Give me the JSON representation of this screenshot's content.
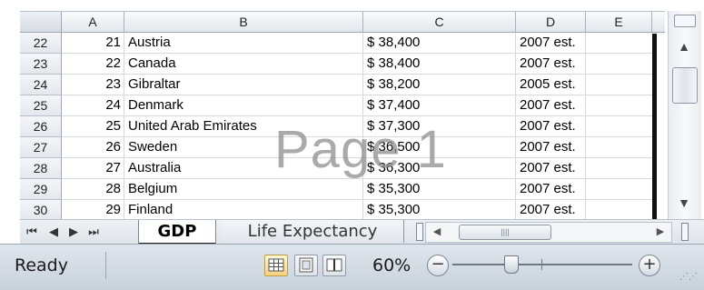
{
  "columns": [
    "A",
    "B",
    "C",
    "D",
    "E"
  ],
  "rows": [
    {
      "row": "22",
      "a": "21",
      "b": "Austria",
      "c": "$ 38,400",
      "d": "2007 est."
    },
    {
      "row": "23",
      "a": "22",
      "b": "Canada",
      "c": "$ 38,400",
      "d": "2007 est."
    },
    {
      "row": "24",
      "a": "23",
      "b": "Gibraltar",
      "c": "$ 38,200",
      "d": "2005 est."
    },
    {
      "row": "25",
      "a": "24",
      "b": "Denmark",
      "c": "$ 37,400",
      "d": "2007 est."
    },
    {
      "row": "26",
      "a": "25",
      "b": "United Arab Emirates",
      "c": "$ 37,300",
      "d": "2007 est."
    },
    {
      "row": "27",
      "a": "26",
      "b": "Sweden",
      "c": "$ 36,500",
      "d": "2007 est."
    },
    {
      "row": "28",
      "a": "27",
      "b": "Australia",
      "c": "$ 36,300",
      "d": "2007 est."
    },
    {
      "row": "29",
      "a": "28",
      "b": "Belgium",
      "c": "$ 35,300",
      "d": "2007 est."
    },
    {
      "row": "30",
      "a": "29",
      "b": "Finland",
      "c": "$ 35,300",
      "d": "2007 est."
    }
  ],
  "watermark": "Page 1",
  "sheet_nav": {
    "first": "⏮",
    "prev": "◀",
    "next": "▶",
    "last": "⏭"
  },
  "tabs": [
    {
      "label": "GDP",
      "active": true
    },
    {
      "label": "Life Expectancy",
      "active": false
    }
  ],
  "status": {
    "text": "Ready",
    "zoom": "60%",
    "zoom_out": "−",
    "zoom_in": "+",
    "zoom_fraction": 0.6
  },
  "icons": {
    "view_normal": "grid-view-icon",
    "view_layout": "page-layout-icon",
    "view_break": "page-break-preview-icon"
  },
  "colors": {
    "accent": "#f3d27e",
    "chrome": "#dfe5ec"
  }
}
